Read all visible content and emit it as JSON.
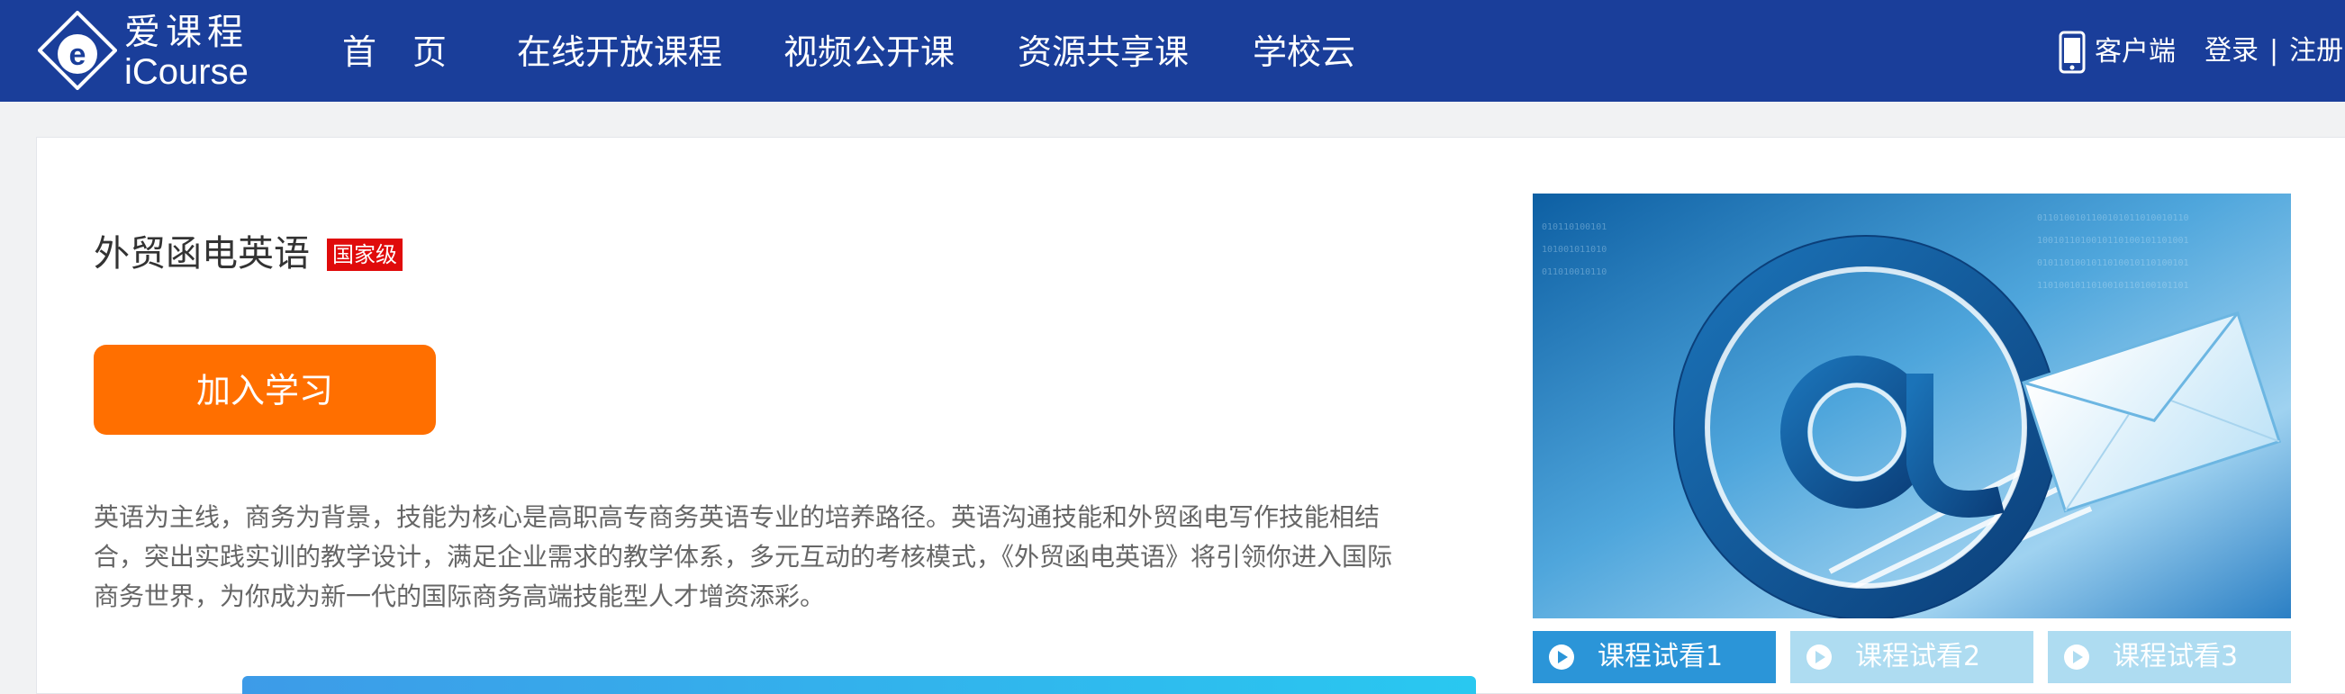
{
  "brand": {
    "name_cn": "爱课程",
    "name_en": "iCourse"
  },
  "nav": {
    "home": "首页",
    "open_courses": "在线开放课程",
    "video_courses": "视频公开课",
    "share_courses": "资源共享课",
    "school_cloud": "学校云"
  },
  "header": {
    "client": "客户端",
    "login": "登录",
    "separator": "|",
    "register": "注册"
  },
  "course": {
    "title": "外贸函电英语",
    "badge": "国家级",
    "join_button": "加入学习",
    "description": "英语为主线，商务为背景，技能为核心是高职高专商务英语专业的培养路径。英语沟通技能和外贸函电写作技能相结合，突出实践实训的教学设计，满足企业需求的教学体系，多元互动的考核模式，《外贸函电英语》将引领你进入国际商务世界，为你成为新一代的国际商务高端技能型人才增资添彩。"
  },
  "trials": [
    {
      "label": "课程试看1",
      "active": true
    },
    {
      "label": "课程试看2",
      "active": false
    },
    {
      "label": "课程试看3",
      "active": false
    }
  ],
  "colors": {
    "nav_bg": "#1a3e9a",
    "join_button": "#ff6f00",
    "badge": "#e00b0b",
    "trial_active": "#2b95d8",
    "trial_inactive": "#aedcf1"
  },
  "icons": {
    "logo": "icourse-logo-icon",
    "client": "mobile-phone-icon",
    "trial": "play-circle-icon",
    "cover": "email-at-envelope-illustration"
  }
}
